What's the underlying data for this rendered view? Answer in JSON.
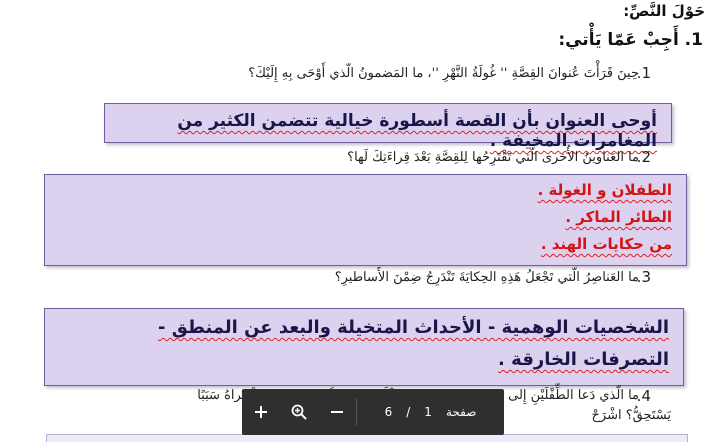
{
  "document": {
    "section_heading": "حَوْلَ النَّصِّ:",
    "instruction": "1. أَجِبْ عَمّا يَأْتي:",
    "questions": [
      {
        "number": "1.",
        "text": "حِينَ قَرَأْتَ عُنوانَ القِصَّةِ '' غُولَةُ النَّهْرِ ''، ما المَضمونُ الّذي أَوْحَى بِهِ إِلَيْكَ؟"
      },
      {
        "number": "2.",
        "text": "ما العَناوينُ الأُخرى الّتي تَقْتَرِحُها لِلقِصَّةِ بَعْدَ قِراءَتِكَ لَها؟"
      },
      {
        "number": "3.",
        "text": "ما العَناصِرُ الّتي تَجْعَلُ هَذِهِ الحِكايَةَ تَنْدَرِجُ ضِمْنَ الأَساطيرِ؟"
      },
      {
        "number": "4.",
        "text_line1": "ما الّذي دَعا الطِّفْلَيْنِ إِلى مُتابَعَةِ العُصفورِ، والعَقْلَةِ عَنْ وَصِيَّةِ والِدَيْهِما؟ هَلْ تَراهُ سَبَبًا",
        "text_line2": "يَسْتَحِقُّ؟ اشْرَحْ"
      }
    ],
    "answers": {
      "answer1": "أوحى العنوان بأن القصة أسطورة خيالية تتضمن الكثير من المغامرات المخيفة .",
      "answer2": [
        "الطفلان و الغولة .",
        "الطائر الماكر .",
        "من حكايات الهند ."
      ],
      "answer3": [
        "الشخصيات الوهمية - الأحداث المتخيلة والبعد عن المنطق -",
        "التصرفات الخارقة ."
      ]
    }
  },
  "viewer_toolbar": {
    "zoom_in_icon": "plus-icon",
    "zoom_search_icon": "magnify-icon",
    "zoom_out_icon": "minus-icon",
    "total_pages": "6",
    "separator": "/",
    "current_page": "1",
    "page_label": "صفحة"
  },
  "colors": {
    "answer_box_fill": "#dcd2ef",
    "answer_box_border": "#6f5f9a",
    "answer_dark_text": "#1a164a",
    "answer_red_text": "#d41414",
    "toolbar_bg": "#2f2f2f"
  }
}
